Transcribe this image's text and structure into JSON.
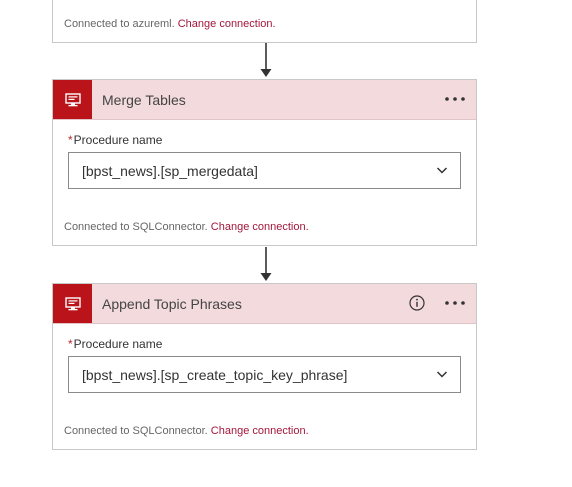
{
  "top_card": {
    "footer_prefix": "Connected to azureml.",
    "footer_link": "Change connection."
  },
  "merge_card": {
    "title": "Merge Tables",
    "field_required_mark": "*",
    "field_label": "Procedure name",
    "field_value": "[bpst_news].[sp_mergedata]",
    "footer_prefix": "Connected to SQLConnector.",
    "footer_link": "Change connection."
  },
  "append_card": {
    "title": "Append Topic Phrases",
    "field_required_mark": "*",
    "field_label": "Procedure name",
    "field_value": "[bpst_news].[sp_create_topic_key_phrase]",
    "footer_prefix": "Connected to SQLConnector.",
    "footer_link": "Change connection."
  },
  "colors": {
    "header_bg": "#f3dadd",
    "icon_tile": "#ba141a",
    "link": "#a3173b",
    "required": "#c1272d"
  },
  "icons": {
    "connector": "sql-monitor-icon",
    "more": "ellipsis-icon",
    "info": "info-icon",
    "dropdown": "chevron-down-icon",
    "flow": "arrow-down-icon"
  }
}
